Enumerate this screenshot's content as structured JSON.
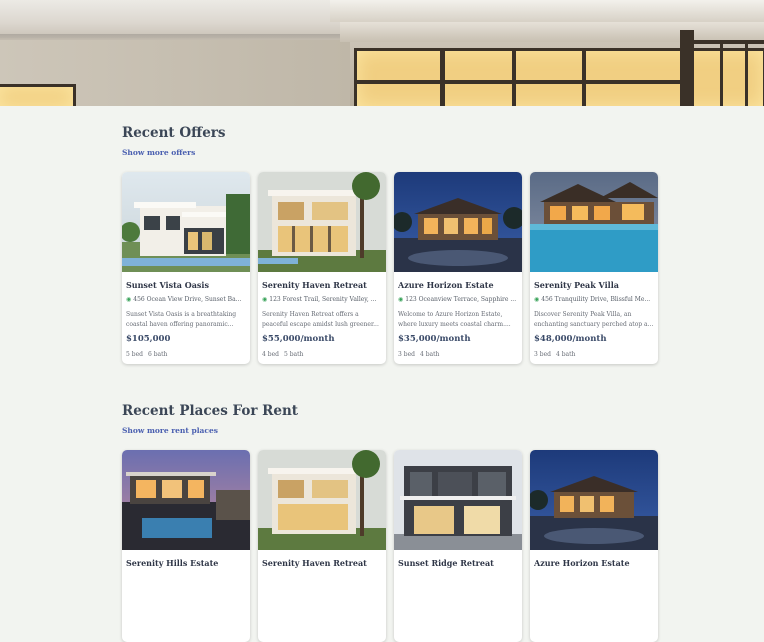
{
  "offers": {
    "title": "Recent Offers",
    "show_more": "Show more offers",
    "cards": [
      {
        "name": "Sunset Vista Oasis",
        "address": "456 Ocean View Drive, Sunset Ba...",
        "desc1": "Sunset Vista Oasis is a breathtaking",
        "desc2": "coastal haven offering panoramic...",
        "price": "$105,000",
        "beds": "5 bed",
        "baths": "6 bath"
      },
      {
        "name": "Serenity Haven Retreat",
        "address": "123 Forest Trail, Serenity Valley, ...",
        "desc1": "Serenity Haven Retreat offers a",
        "desc2": "peaceful escape amidst lush greener...",
        "price": "$55,000/month",
        "beds": "4 bed",
        "baths": "5 bath"
      },
      {
        "name": "Azure Horizon Estate",
        "address": "123 Oceanview Terrace, Sapphire ...",
        "desc1": "Welcome to Azure Horizon Estate,",
        "desc2": "where luxury meets coastal charm....",
        "price": "$35,000/month",
        "beds": "3 bed",
        "baths": "4 bath"
      },
      {
        "name": "Serenity Peak Villa",
        "address": "456 Tranquility Drive, Blissful Me...",
        "desc1": "Discover Serenity Peak Villa, an",
        "desc2": "enchanting sanctuary perched atop a...",
        "price": "$48,000/month",
        "beds": "3 bed",
        "baths": "4 bath"
      }
    ]
  },
  "rent": {
    "title": "Recent Places For Rent",
    "show_more": "Show more rent places",
    "cards": [
      {
        "name": "Serenity Hills Estate"
      },
      {
        "name": "Serenity Haven Retreat"
      },
      {
        "name": "Sunset Ridge Retreat"
      },
      {
        "name": "Azure Horizon Estate"
      }
    ]
  },
  "icons": {
    "location": "map-pin-icon"
  },
  "colors": {
    "accent_link": "#4a5fb0",
    "pin": "#3aa35a",
    "background": "#f2f4f0"
  }
}
